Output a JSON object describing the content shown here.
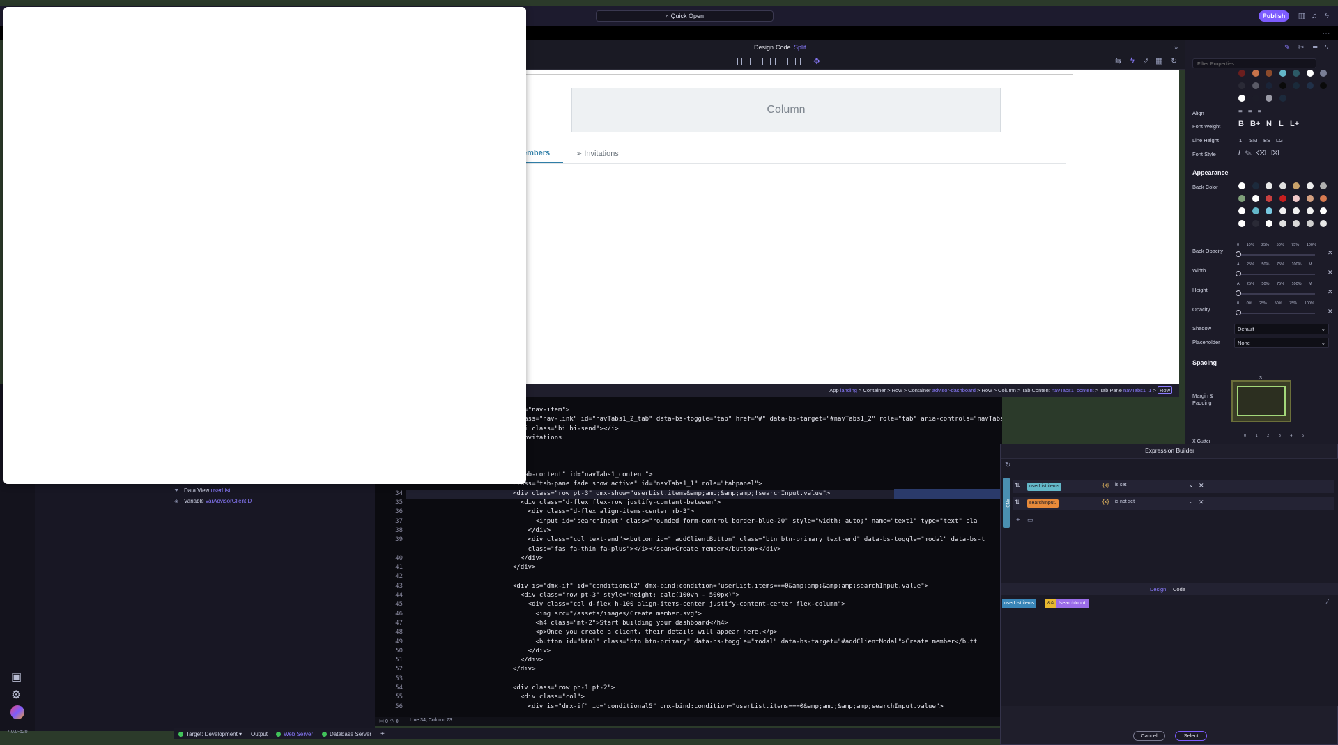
{
  "topbar": {
    "quick_open": "Quick Open",
    "publish": "Publish"
  },
  "modes": {
    "design": "Design",
    "code": "Code",
    "split": "Split"
  },
  "canvas": {
    "column_label": "Column",
    "tab_members": "embers",
    "tab_invitations": "Invitations"
  },
  "tree": {
    "items": [
      {
        "label": "Data View",
        "value": "userList",
        "icon": "funnel-icon"
      },
      {
        "label": "Variable",
        "value": "varAdvisorClientID",
        "icon": "variable-icon"
      }
    ]
  },
  "app": {
    "version": "7.0.0-b20"
  },
  "breadcrumb": {
    "app": "App",
    "app_val": "landing",
    "c1": "Container",
    "row1": "Row",
    "c2": "Container",
    "c2_val": "advisor-dashboard",
    "row2": "Row",
    "column": "Column",
    "tabcontent": "Tab Content",
    "tabcontent_val": "navTabs1_content",
    "tabpane": "Tab Pane",
    "tabpane_val": "navTabs1_1",
    "current": "Row"
  },
  "code": {
    "lines": [
      {
        "n": "",
        "t": "ass=\"nav-item\">"
      },
      {
        "n": "",
        "t": " class=\"nav-link\" id=\"navTabs1_2_tab\" data-bs-toggle=\"tab\" href=\"#\" data-bs-target=\"#navTabs1_2\" role=\"tab\" aria-controls=\"navTabs1_2\" aria-selected=\"false\">"
      },
      {
        "n": "",
        "t": "  <i class=\"bi bi-send\"></i>"
      },
      {
        "n": "",
        "t": "  Invitations"
      },
      {
        "n": "",
        "t": "a>"
      },
      {
        "n": "",
        "t": ""
      },
      {
        "n": "",
        "t": ""
      },
      {
        "n": "",
        "t": "=\"tab-content\" id=\"navTabs1_content\">"
      },
      {
        "n": "",
        "t": "class=\"tab-pane fade show active\" id=\"navTabs1_1\" role=\"tabpanel\">"
      },
      {
        "n": "34",
        "t": "<div class=\"row pt-3\" dmx-show=\"userList.items&amp;amp;&amp;amp;!searchInput.value\">"
      },
      {
        "n": "35",
        "t": "  <div class=\"d-flex flex-row justify-content-between\">"
      },
      {
        "n": "36",
        "t": "    <div class=\"d-flex align-items-center mb-3\">"
      },
      {
        "n": "37",
        "t": "      <input id=\"searchInput\" class=\"rounded form-control border-blue-20\" style=\"width: auto;\" name=\"text1\" type=\"text\" pla"
      },
      {
        "n": "38",
        "t": "    </div>"
      },
      {
        "n": "39",
        "t": "    <div class=\"col text-end\"><button id=\" addClientButton\" class=\"btn btn-primary text-end\" data-bs-toggle=\"modal\" data-bs-t"
      },
      {
        "n": "",
        "t": "    class=\"fas fa-thin fa-plus\"></i></span>Create member</button></div>"
      },
      {
        "n": "40",
        "t": "  </div>"
      },
      {
        "n": "41",
        "t": "</div>"
      },
      {
        "n": "42",
        "t": ""
      },
      {
        "n": "43",
        "t": "<div is=\"dmx-if\" id=\"conditional2\" dmx-bind:condition=\"userList.items===0&amp;amp;&amp;amp;searchInput.value\">"
      },
      {
        "n": "44",
        "t": "  <div class=\"row pt-3\" style=\"height: calc(100vh - 500px)\">"
      },
      {
        "n": "45",
        "t": "    <div class=\"col d-flex h-100 align-items-center justify-content-center flex-column\">"
      },
      {
        "n": "46",
        "t": "      <img src=\"/assets/images/Create member.svg\">"
      },
      {
        "n": "47",
        "t": "      <h4 class=\"mt-2\">Start building your dashboard</h4>"
      },
      {
        "n": "48",
        "t": "      <p>Once you create a client, their details will appear here.</p>"
      },
      {
        "n": "49",
        "t": "      <button id=\"btn1\" class=\"btn btn-primary\" data-bs-toggle=\"modal\" data-bs-target=\"#addClientModal\">Create member</butt"
      },
      {
        "n": "50",
        "t": "    </div>"
      },
      {
        "n": "51",
        "t": "  </div>"
      },
      {
        "n": "52",
        "t": "</div>"
      },
      {
        "n": "53",
        "t": ""
      },
      {
        "n": "54",
        "t": "<div class=\"row pb-1 pt-2\">"
      },
      {
        "n": "55",
        "t": "  <div class=\"col\">"
      },
      {
        "n": "56",
        "t": "    <div is=\"dmx-if\" id=\"conditional5\" dmx-bind:condition=\"userList.items===0&amp;amp;&amp;amp;searchInput.value\">"
      }
    ],
    "status": "Line 34, Column 73",
    "problems": "0 ⚠ 0"
  },
  "statusbar": {
    "target": "Target: Development",
    "output": "Output",
    "web_server": "Web Server",
    "db_server": "Database Server"
  },
  "props": {
    "filter_placeholder": "Filter Properties",
    "align": "Align",
    "font_weight": "Font Weight",
    "line_height": "Line Height",
    "font_style": "Font Style",
    "fw": [
      "B",
      "B+",
      "N",
      "L",
      "L+"
    ],
    "lh": [
      "1",
      "SM",
      "BS",
      "LG"
    ],
    "appearance": "Appearance",
    "back_color": "Back Color",
    "back_opacity": "Back Opacity",
    "width": "Width",
    "height": "Height",
    "opacity": "Opacity",
    "ticks_opacity": "0 10% 25% 50% 75% 100%",
    "ticks_size": "A 25% 50% 75% 100% M",
    "ticks_op2": "0 0% 25% 50% 75% 100%",
    "shadow": "Shadow",
    "shadow_val": "Default",
    "placeholder": "Placeholder",
    "placeholder_val": "None",
    "spacing": "Spacing",
    "margin_padding": "Margin & Padding",
    "margin_top": "3",
    "gutter": "X Gutter",
    "scale": "0 1 2 3 4 5",
    "colors": [
      "#6b1e1e",
      "#c8734a",
      "#8b4a2b",
      "#63b7c9",
      "#2c5a66",
      "#ffffff",
      "#7a7f96",
      "#2a2a36",
      "#5a5a66",
      "#1a2438",
      "#0a0a0a",
      "#1a2a3a",
      "#203048",
      "#0a0a0a",
      "#ffffff",
      "#1c1c28",
      "#9a9aa6",
      "#1c2a3c"
    ],
    "back_colors": [
      "#ffffff",
      "#1c2a3c",
      "#e8e8e8",
      "#e0e0e0",
      "#c9a26a",
      "#ececec",
      "#b0b0b0",
      "#7fa07a",
      "#ffffff",
      "#c84040",
      "#c81e1e",
      "#f0c8c8",
      "#d4a080",
      "#d87a50",
      "#ffffff",
      "#63b7c9",
      "#78c8e0",
      "#f0f0f0",
      "#f0f0f0",
      "#f0f0f0",
      "#ffffff",
      "#ffffff",
      "#2a2a36",
      "#ffffff",
      "#e0e0e0",
      "#d8d8d8",
      "#cfcfcf",
      "#e8e8e8"
    ]
  },
  "expr": {
    "title": "Expression Builder",
    "and": "AND",
    "rows": [
      {
        "field": "userList.items",
        "op": "is set",
        "color": "#63b7c9"
      },
      {
        "field": "searchInput.",
        "op": "is not set",
        "color": "#e88a3a"
      }
    ],
    "func": "{x}",
    "tab_design": "Design",
    "tab_code": "Code",
    "pills": [
      {
        "text": "userList.items",
        "color": "#3a86b8"
      },
      {
        "text": "&&",
        "color": "#e8b830"
      },
      {
        "text": "!searchInput.",
        "color": "#9a6ce8"
      }
    ],
    "cancel": "Cancel",
    "select": "Select"
  }
}
